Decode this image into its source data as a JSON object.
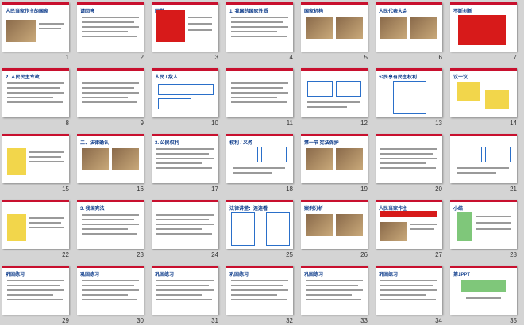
{
  "slides": [
    {
      "n": "1",
      "title": "人民当家作主的国家",
      "style": "cover"
    },
    {
      "n": "2",
      "title": "请回答",
      "style": "text"
    },
    {
      "n": "3",
      "title": "国徽",
      "style": "emblem"
    },
    {
      "n": "4",
      "title": "1. 我国的国家性质",
      "style": "text"
    },
    {
      "n": "5",
      "title": "国家机构",
      "style": "photo"
    },
    {
      "n": "6",
      "title": "人民代表大会",
      "style": "photo"
    },
    {
      "n": "7",
      "title": "不断创新",
      "style": "map"
    },
    {
      "n": "8",
      "title": "2. 人民民主专政",
      "style": "text"
    },
    {
      "n": "9",
      "title": "",
      "style": "text"
    },
    {
      "n": "10",
      "title": "人民 / 敌人",
      "style": "diagram"
    },
    {
      "n": "11",
      "title": "",
      "style": "text"
    },
    {
      "n": "12",
      "title": "",
      "style": "boxes"
    },
    {
      "n": "13",
      "title": "公民享有民主权利",
      "style": "ring"
    },
    {
      "n": "14",
      "title": "议一议",
      "style": "bubble"
    },
    {
      "n": "15",
      "title": "",
      "style": "cartoon"
    },
    {
      "n": "16",
      "title": "二、法律确认",
      "style": "photo"
    },
    {
      "n": "17",
      "title": "3. 公民权利",
      "style": "text"
    },
    {
      "n": "18",
      "title": "权利 / 义务",
      "style": "boxes"
    },
    {
      "n": "19",
      "title": "第一节 宪法保护",
      "style": "photo"
    },
    {
      "n": "20",
      "title": "",
      "style": "text"
    },
    {
      "n": "21",
      "title": "",
      "style": "boxes"
    },
    {
      "n": "22",
      "title": "",
      "style": "cartoon"
    },
    {
      "n": "23",
      "title": "3. 我国宪法",
      "style": "text"
    },
    {
      "n": "24",
      "title": "",
      "style": "text"
    },
    {
      "n": "25",
      "title": "法律讲堂：连连看",
      "style": "lines"
    },
    {
      "n": "26",
      "title": "案例分析",
      "style": "photo"
    },
    {
      "n": "27",
      "title": "人民当家作主",
      "style": "banner"
    },
    {
      "n": "28",
      "title": "小结",
      "style": "tree"
    },
    {
      "n": "29",
      "title": "巩固练习",
      "style": "text"
    },
    {
      "n": "30",
      "title": "巩固练习",
      "style": "text"
    },
    {
      "n": "31",
      "title": "巩固练习",
      "style": "text"
    },
    {
      "n": "32",
      "title": "巩固练习",
      "style": "text"
    },
    {
      "n": "33",
      "title": "巩固练习",
      "style": "text"
    },
    {
      "n": "34",
      "title": "巩固练习",
      "style": "text"
    },
    {
      "n": "35",
      "title": "第1PPT",
      "style": "logo"
    }
  ]
}
